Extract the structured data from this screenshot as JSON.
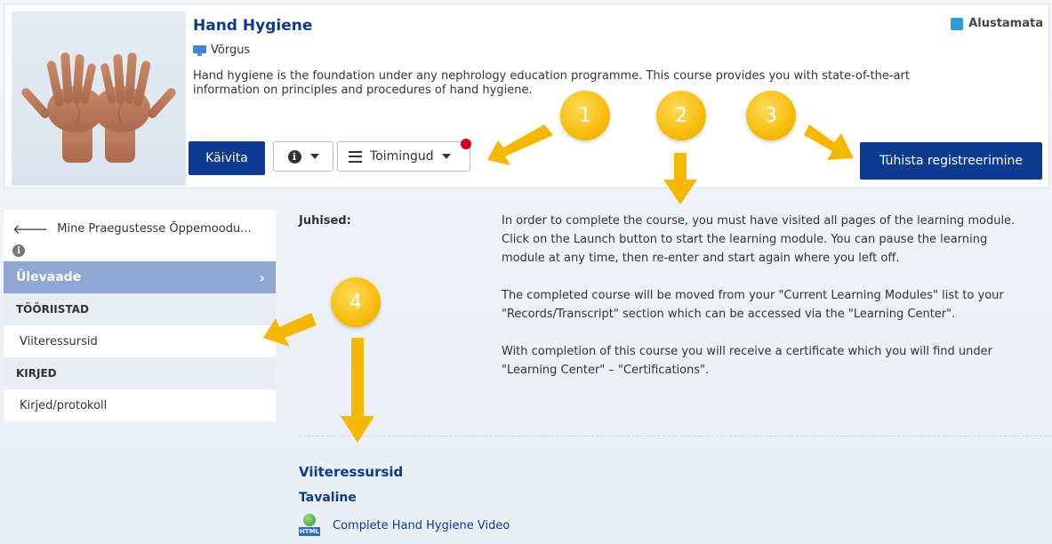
{
  "course": {
    "title": "Hand Hygiene",
    "delivery": "Võrgus",
    "description": "Hand hygiene is the foundation under any nephrology education programme. This course provides you with state-of-the-art information on principles and procedures of hand hygiene.",
    "status": "Alustamata",
    "status_color": "#2e9ad6"
  },
  "actions": {
    "launch_label": "Käivita",
    "actions_label": "Toimingud",
    "unregister_label": "Tühista registreerimine"
  },
  "sidebar": {
    "back_label": "Mine Praegustesse Õppemoodu...",
    "overview_label": "Ülevaade",
    "sections": [
      {
        "heading": "TÖÖRIISTAD",
        "items": [
          "Viiteressursid"
        ]
      },
      {
        "heading": "KIRJED",
        "items": [
          "Kirjed/protokoll"
        ]
      }
    ]
  },
  "instructions": {
    "label": "Juhised:",
    "paragraphs": [
      "In order to complete the course, you must have visited all pages of the learning module. Click on the Launch button to start the learning module. You can pause the learning module at any time, then re-enter and start again where you left off.",
      "The completed course will be moved from your \"Current Learning Modules\" list to your \"Records/Transcript\" section which can be accessed via the \"Learning Center\".",
      "With completion of this course you will receive a certificate which you will find under \"Learning Center\" – \"Certifications\"."
    ]
  },
  "references": {
    "title": "Viiteressursid",
    "subtitle": "Tavaline",
    "icon_label": "HTML",
    "link": "Complete Hand Hygiene Video"
  },
  "annotations": {
    "badges": [
      "1",
      "2",
      "3",
      "4"
    ],
    "color": "#f5b800"
  },
  "colors": {
    "primary": "#0d3b91",
    "heading": "#0e3a8c",
    "sidebar_active": "#8fa6d3",
    "notification": "#d0021b"
  }
}
